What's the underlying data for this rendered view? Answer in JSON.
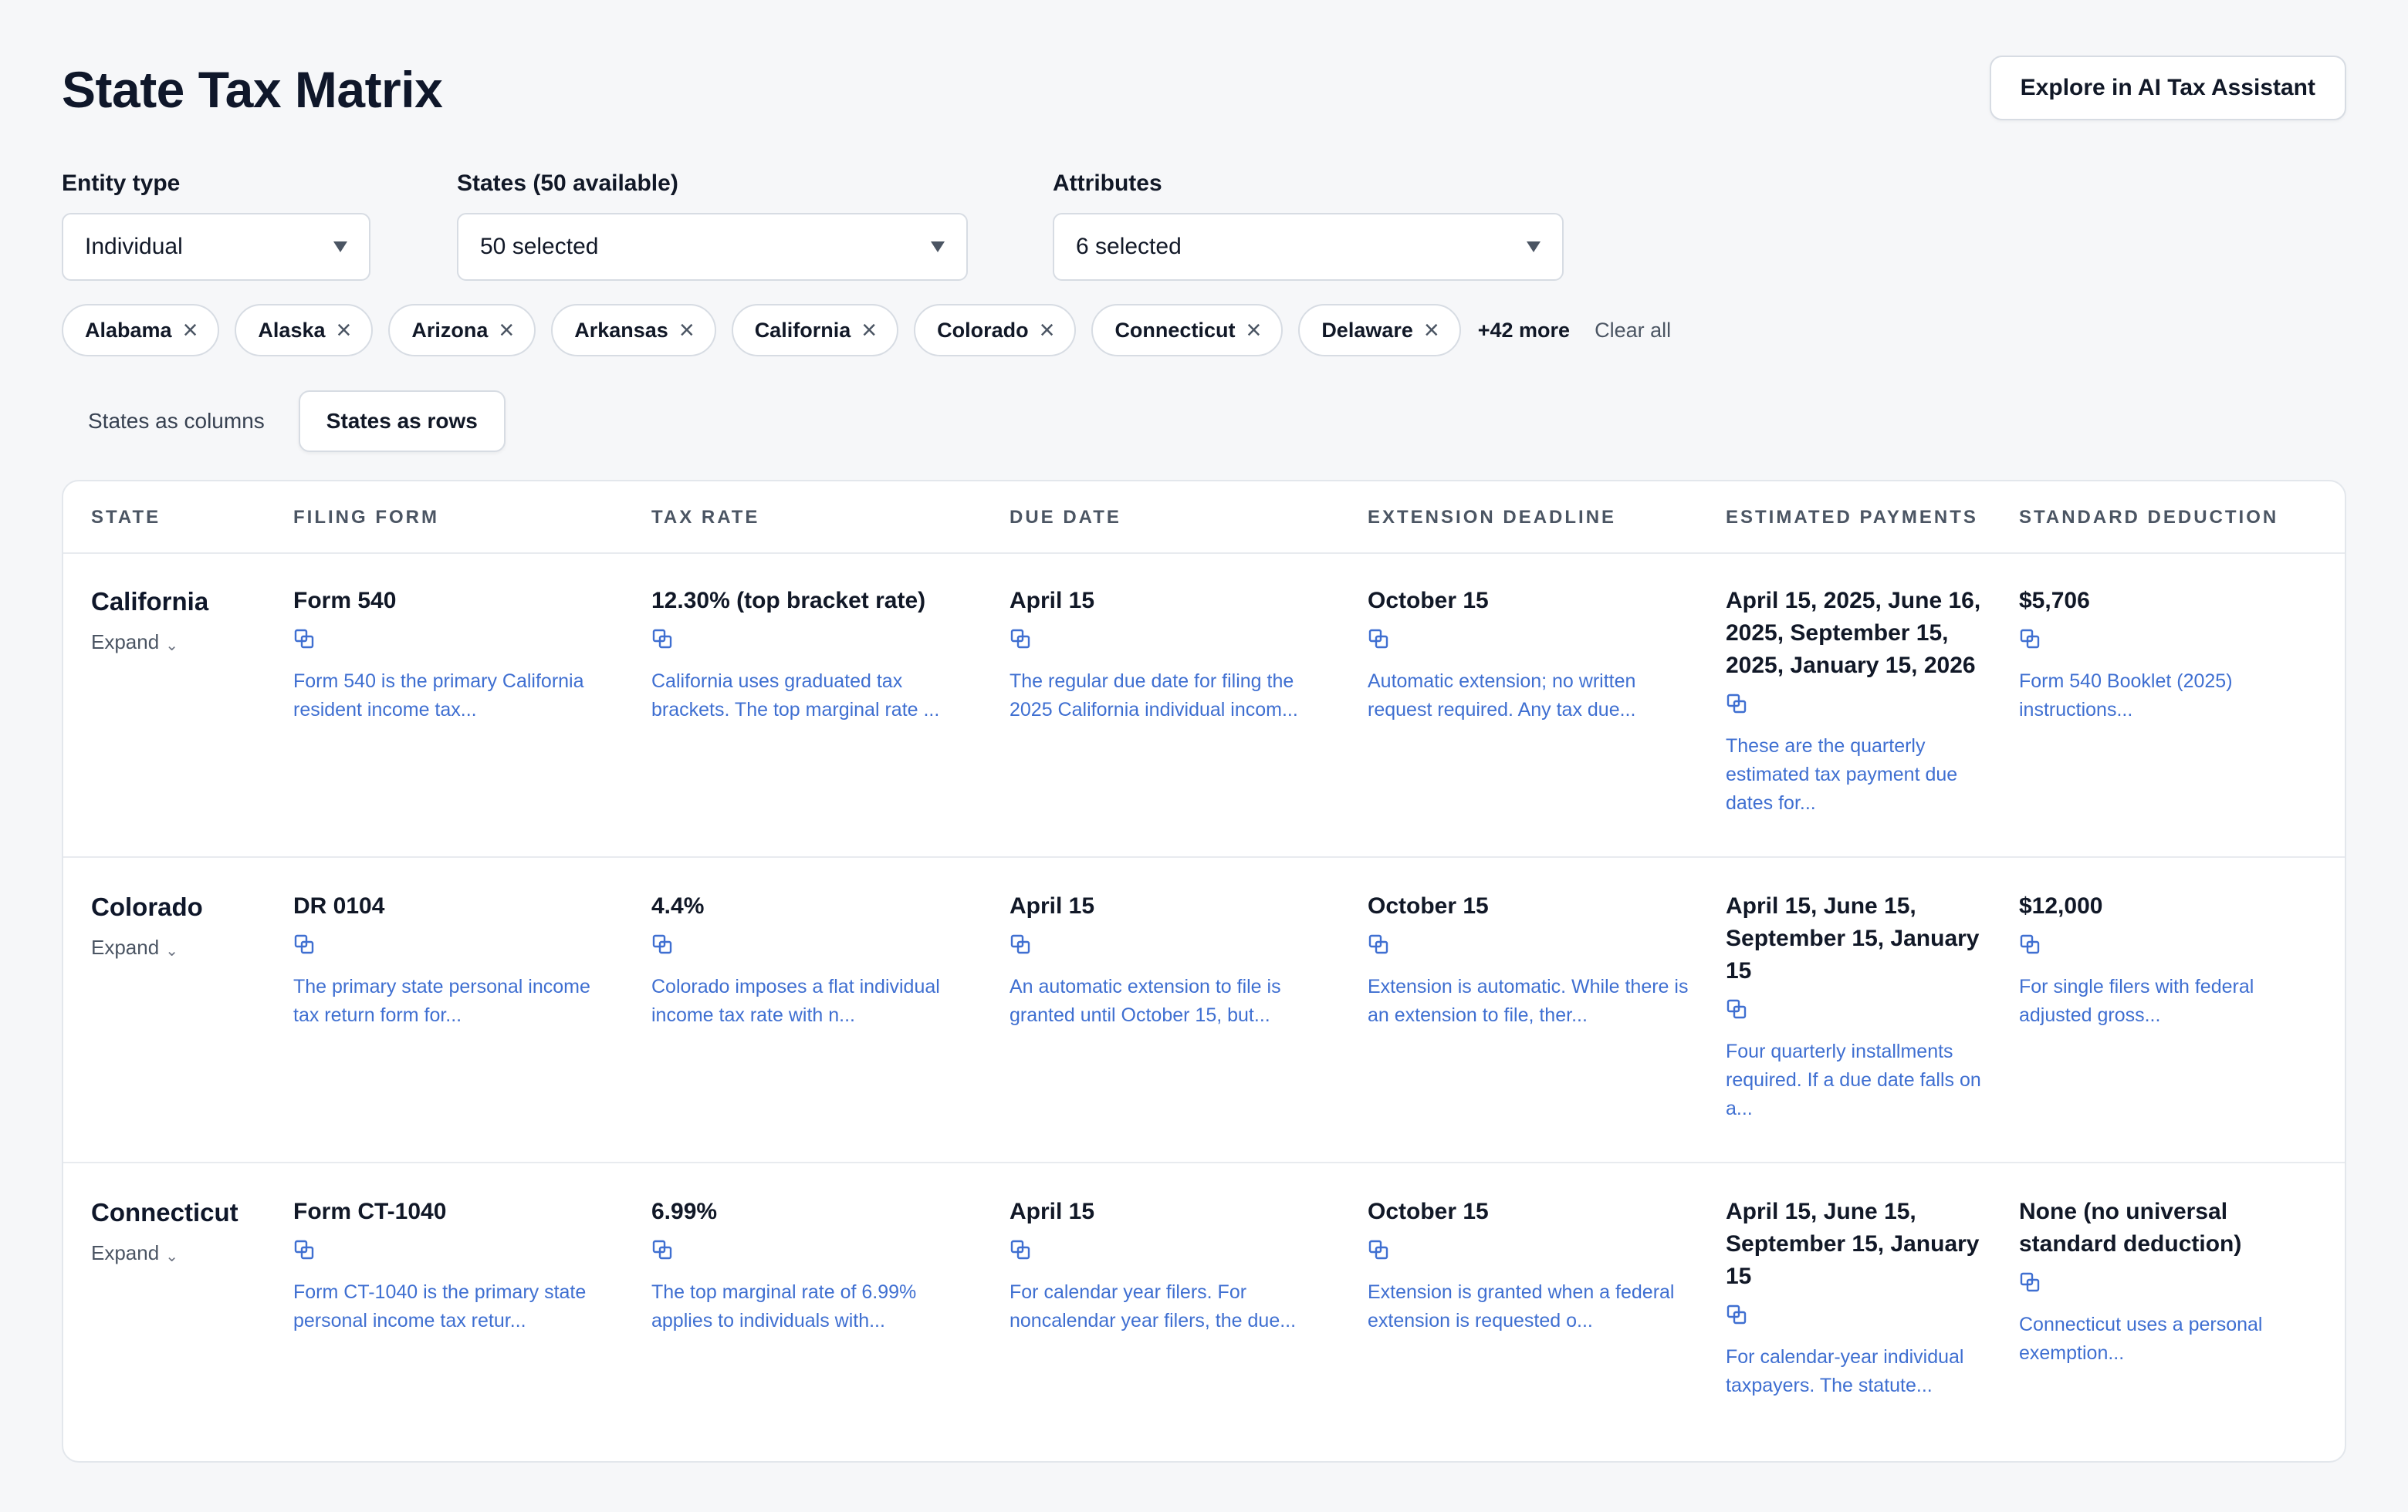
{
  "page": {
    "title": "State Tax Matrix"
  },
  "header": {
    "explore_label": "Explore in AI Tax Assistant"
  },
  "filters": {
    "entity": {
      "label": "Entity type",
      "value": "Individual"
    },
    "states": {
      "label": "States (50 available)",
      "value": "50 selected"
    },
    "attributes": {
      "label": "Attributes",
      "value": "6 selected"
    }
  },
  "chips": [
    "Alabama",
    "Alaska",
    "Arizona",
    "Arkansas",
    "California",
    "Colorado",
    "Connecticut",
    "Delaware"
  ],
  "chips_more": "+42 more",
  "clear_all": "Clear all",
  "view_toggle": {
    "columns": "States as columns",
    "rows": "States as rows",
    "active": "rows"
  },
  "columns": [
    "STATE",
    "FILING FORM",
    "TAX RATE",
    "DUE DATE",
    "EXTENSION DEADLINE",
    "ESTIMATED PAYMENTS",
    "STANDARD DEDUCTION"
  ],
  "expand_label": "Expand",
  "rows": [
    {
      "state": "California",
      "cells": [
        {
          "value": "Form 540",
          "note": "Form 540 is the primary California resident income tax..."
        },
        {
          "value": "12.30% (top bracket rate)",
          "note": "California uses graduated tax brackets. The top marginal rate ..."
        },
        {
          "value": "April 15",
          "note": "The regular due date for filing the 2025 California individual incom..."
        },
        {
          "value": "October 15",
          "note": "Automatic extension; no written request required. Any tax due..."
        },
        {
          "value": "April 15, 2025, June 16, 2025, September 15, 2025, January 15, 2026",
          "note": "These are the quarterly estimated tax payment due dates for..."
        },
        {
          "value": "$5,706",
          "note": "Form 540 Booklet (2025) instructions..."
        }
      ]
    },
    {
      "state": "Colorado",
      "cells": [
        {
          "value": "DR 0104",
          "note": "The primary state personal income tax return form for..."
        },
        {
          "value": "4.4%",
          "note": "Colorado imposes a flat individual income tax rate with n..."
        },
        {
          "value": "April 15",
          "note": "An automatic extension to file is granted until October 15, but..."
        },
        {
          "value": "October 15",
          "note": "Extension is automatic. While there is an extension to file, ther..."
        },
        {
          "value": "April 15, June 15, September 15, January 15",
          "note": "Four quarterly installments required. If a due date falls on a..."
        },
        {
          "value": "$12,000",
          "note": "For single filers with federal adjusted gross..."
        }
      ]
    },
    {
      "state": "Connecticut",
      "cells": [
        {
          "value": "Form CT-1040",
          "note": "Form CT-1040 is the primary state personal income tax retur..."
        },
        {
          "value": "6.99%",
          "note": "The top marginal rate of 6.99% applies to individuals with..."
        },
        {
          "value": "April 15",
          "note": "For calendar year filers. For noncalendar year filers, the due..."
        },
        {
          "value": "October 15",
          "note": "Extension is granted when a federal extension is requested o..."
        },
        {
          "value": "April 15, June 15, September 15, January 15",
          "note": "For calendar-year individual taxpayers. The statute..."
        },
        {
          "value": "None (no universal standard deduction)",
          "note": "Connecticut uses a personal exemption..."
        }
      ]
    }
  ],
  "colors": {
    "link": "#3f6fd1",
    "border": "#d7dce3",
    "background": "#f6f7f9"
  },
  "icons": {
    "chip_remove": "close-icon",
    "dropdown": "caret-down-icon",
    "citation": "copy-source-icon",
    "expand": "chevron-down-icon"
  }
}
